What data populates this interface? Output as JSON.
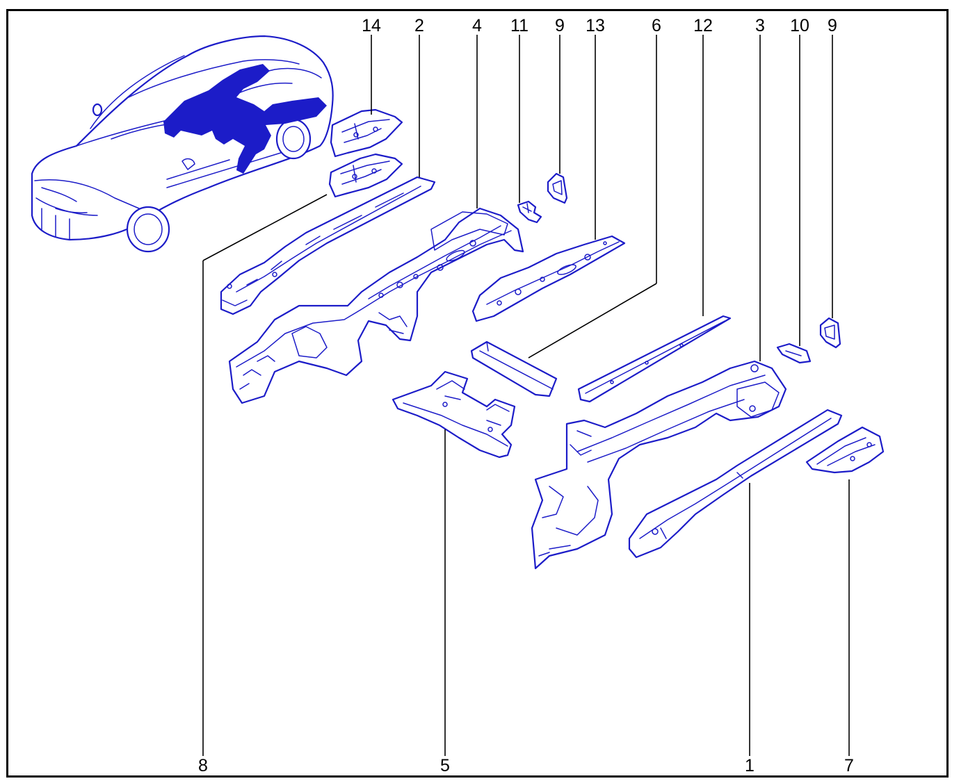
{
  "colors": {
    "line": "#1c1cc8",
    "fill": "#ffffff",
    "highlight": "#1212b0",
    "leader": "#000000",
    "frame": "#000000"
  },
  "labels": {
    "l14": "14",
    "l2": "2",
    "l4": "4",
    "l11": "11",
    "l9a": "9",
    "l13": "13",
    "l6": "6",
    "l12": "12",
    "l3": "3",
    "l10": "10",
    "l9b": "9",
    "l8": "8",
    "l5": "5",
    "l1": "1",
    "l7": "7"
  }
}
